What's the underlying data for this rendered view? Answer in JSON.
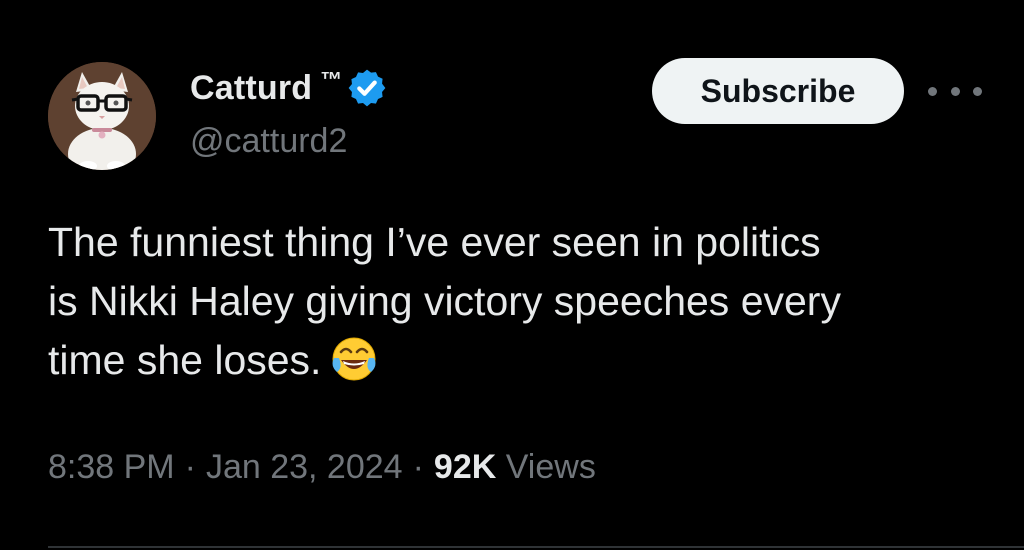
{
  "colors": {
    "background": "#000000",
    "text_primary": "#e7e9ea",
    "text_secondary": "#71767b",
    "verified_badge": "#1d9bf0",
    "button_bg": "#eff3f4",
    "button_text": "#0f1419",
    "divider": "#2f3336"
  },
  "author": {
    "display_name": "Catturd",
    "tm_mark": "™",
    "handle": "@catturd2",
    "avatar_icon": "cat-with-glasses-avatar",
    "verified_icon": "verified-badge-icon"
  },
  "actions": {
    "subscribe_label": "Subscribe",
    "more_icon": "more-horizontal-icon"
  },
  "tweet": {
    "text": "The funniest thing I’ve ever seen in politics\nis Nikki Haley giving victory speeches every\ntime she loses.",
    "emoji_icon": "face-with-tears-of-joy-emoji"
  },
  "meta": {
    "time": "8:38 PM",
    "date": "Jan 23, 2024",
    "separator": "·",
    "views_count": "92K",
    "views_label": "Views"
  }
}
